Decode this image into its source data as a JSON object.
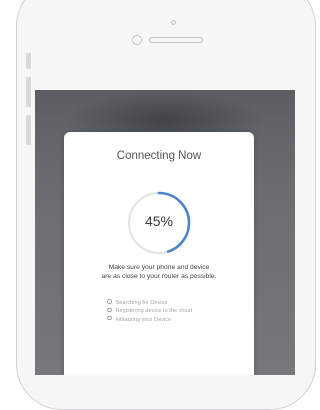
{
  "dialog": {
    "title": "Connecting Now",
    "progress_label": "45%",
    "progress": 0.45,
    "instruction_lines": [
      "Make sure your phone and device",
      "are as close to your router as possible."
    ],
    "steps": [
      "Searching for Device",
      "Registering device to the cloud",
      "Initializing your Device"
    ]
  },
  "colors": {
    "progress_accent": "#4a86c8",
    "progress_track": "#e3e5e8",
    "screen_overlay": "#6a6e71"
  }
}
